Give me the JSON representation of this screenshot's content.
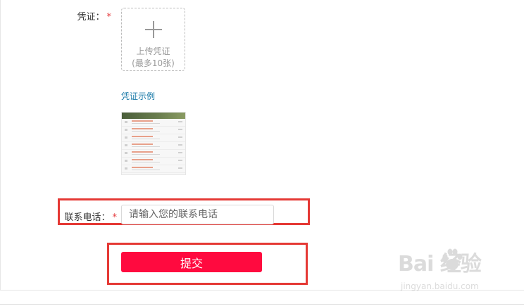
{
  "form": {
    "voucher": {
      "label": "凭证：",
      "required_mark": "*",
      "upload_text": "上传凭证",
      "upload_limit": "(最多10张)",
      "example_link": "凭证示例"
    },
    "phone": {
      "label": "联系电话：",
      "required_mark": "*",
      "placeholder": "请输入您的联系电话",
      "value": ""
    },
    "submit_label": "提交"
  },
  "watermark": {
    "brand": "Bai  经验",
    "url": "jingyan.baidu.com"
  },
  "colors": {
    "accent": "#ff0a3f",
    "highlight": "#e53935",
    "link": "#1a7aa8",
    "required": "#e4393c"
  }
}
